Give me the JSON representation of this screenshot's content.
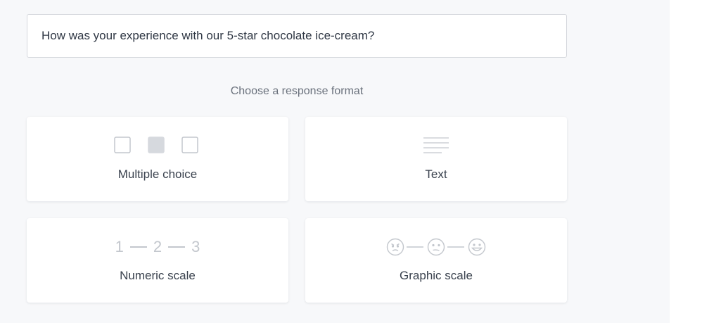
{
  "question": {
    "value": "How was your experience with our 5-star chocolate ice-cream?"
  },
  "prompt": "Choose a response format",
  "formats": [
    {
      "label": "Multiple choice",
      "icon": "checkbox-choices-icon"
    },
    {
      "label": "Text",
      "icon": "text-lines-icon"
    },
    {
      "label": "Numeric scale",
      "icon": "numeric-scale-icon",
      "scale": [
        "1",
        "2",
        "3"
      ]
    },
    {
      "label": "Graphic scale",
      "icon": "emoji-scale-icon"
    }
  ],
  "colors": {
    "panel_background": "#f7f8fa",
    "card_background": "#ffffff",
    "icon_gray": "#c3c7cd",
    "text_dark": "#3a424e"
  }
}
